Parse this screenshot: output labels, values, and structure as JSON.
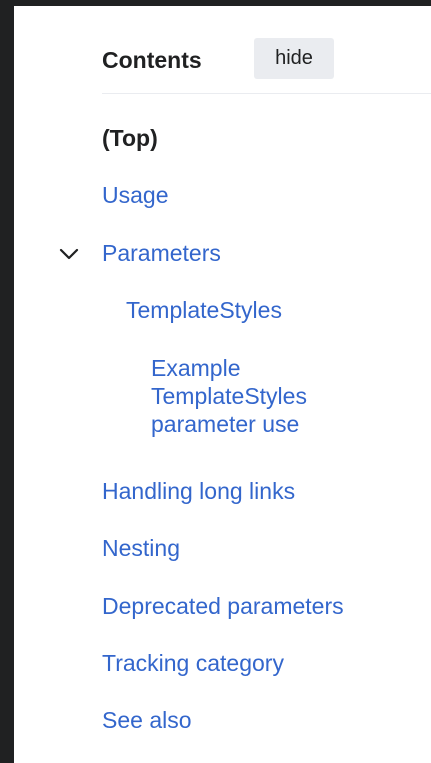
{
  "toc": {
    "title": "Contents",
    "hide_label": "hide",
    "items": [
      {
        "label": "(Top)"
      },
      {
        "label": "Usage"
      },
      {
        "label": "Parameters",
        "expanded": true,
        "toggle_icon": "chevron-down-icon"
      },
      {
        "label": "TemplateStyles"
      },
      {
        "label": "Example TemplateStyles parameter use"
      },
      {
        "label": "Handling long links"
      },
      {
        "label": "Nesting"
      },
      {
        "label": "Deprecated parameters"
      },
      {
        "label": "Tracking category"
      },
      {
        "label": "See also"
      }
    ]
  },
  "colors": {
    "link": "#3366cc",
    "text": "#202122",
    "button_bg": "#eaecf0",
    "frame": "#202122"
  }
}
